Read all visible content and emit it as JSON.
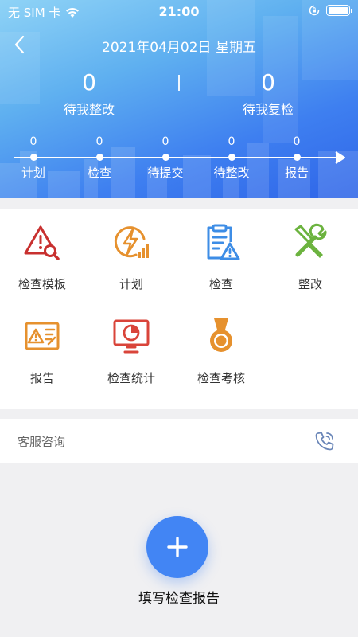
{
  "status_bar": {
    "carrier": "无 SIM 卡",
    "time": "21:00"
  },
  "header": {
    "date": "2021年04月02日  星期五",
    "stats": [
      {
        "value": "0",
        "label": "待我整改"
      },
      {
        "value": "0",
        "label": "待我复检"
      }
    ],
    "timeline": [
      {
        "count": "0",
        "label": "计划"
      },
      {
        "count": "0",
        "label": "检查"
      },
      {
        "count": "0",
        "label": "待提交"
      },
      {
        "count": "0",
        "label": "待整改"
      },
      {
        "count": "0",
        "label": "报告"
      }
    ]
  },
  "menu": [
    {
      "label": "检查模板",
      "icon": "warning-search-icon",
      "color": "#c8302f"
    },
    {
      "label": "计划",
      "icon": "lightning-chart-icon",
      "color": "#e6912e"
    },
    {
      "label": "检查",
      "icon": "clipboard-warning-icon",
      "color": "#3d8de6"
    },
    {
      "label": "整改",
      "icon": "tools-icon",
      "color": "#6cb33f"
    },
    {
      "label": "报告",
      "icon": "report-warning-icon",
      "color": "#e6912e"
    },
    {
      "label": "检查统计",
      "icon": "monitor-pie-chart-icon",
      "color": "#d9443a"
    },
    {
      "label": "检查考核",
      "icon": "medal-icon",
      "color": "#e6912e"
    }
  ],
  "service": {
    "label": "客服咨询",
    "icon": "phone-icon"
  },
  "fab": {
    "label": "填写检查报告",
    "icon": "plus-icon",
    "color": "#4285f4"
  }
}
